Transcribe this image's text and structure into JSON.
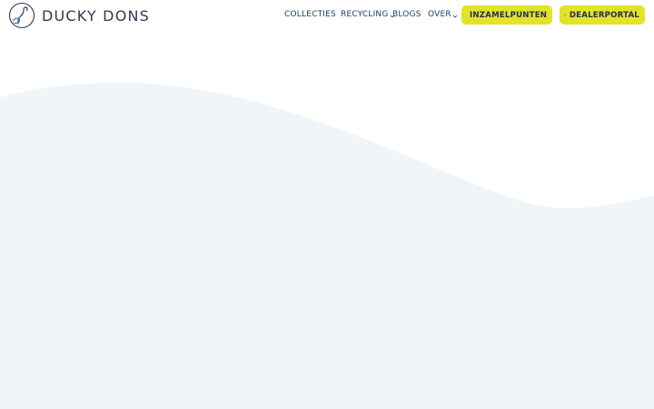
{
  "brand": {
    "name": "DUCKY DONS"
  },
  "nav": {
    "items": [
      {
        "label": "COLLECTIES",
        "has_dropdown": false
      },
      {
        "label": "RECYCLING",
        "has_dropdown": true
      },
      {
        "label": "BLOGS",
        "has_dropdown": false
      },
      {
        "label": "OVER",
        "has_dropdown": true
      }
    ]
  },
  "actions": {
    "inzamelpunten": {
      "label": "INZAMELPUNTEN",
      "icon": "map-pin-icon"
    },
    "dealerportal": {
      "label": "DEALERPORTAL",
      "icon": "storefront-icon"
    }
  },
  "colors": {
    "accent": "#e3e32a",
    "nav_text": "#21405f",
    "wave": "#f0f5f9",
    "background": "#ffffff"
  }
}
